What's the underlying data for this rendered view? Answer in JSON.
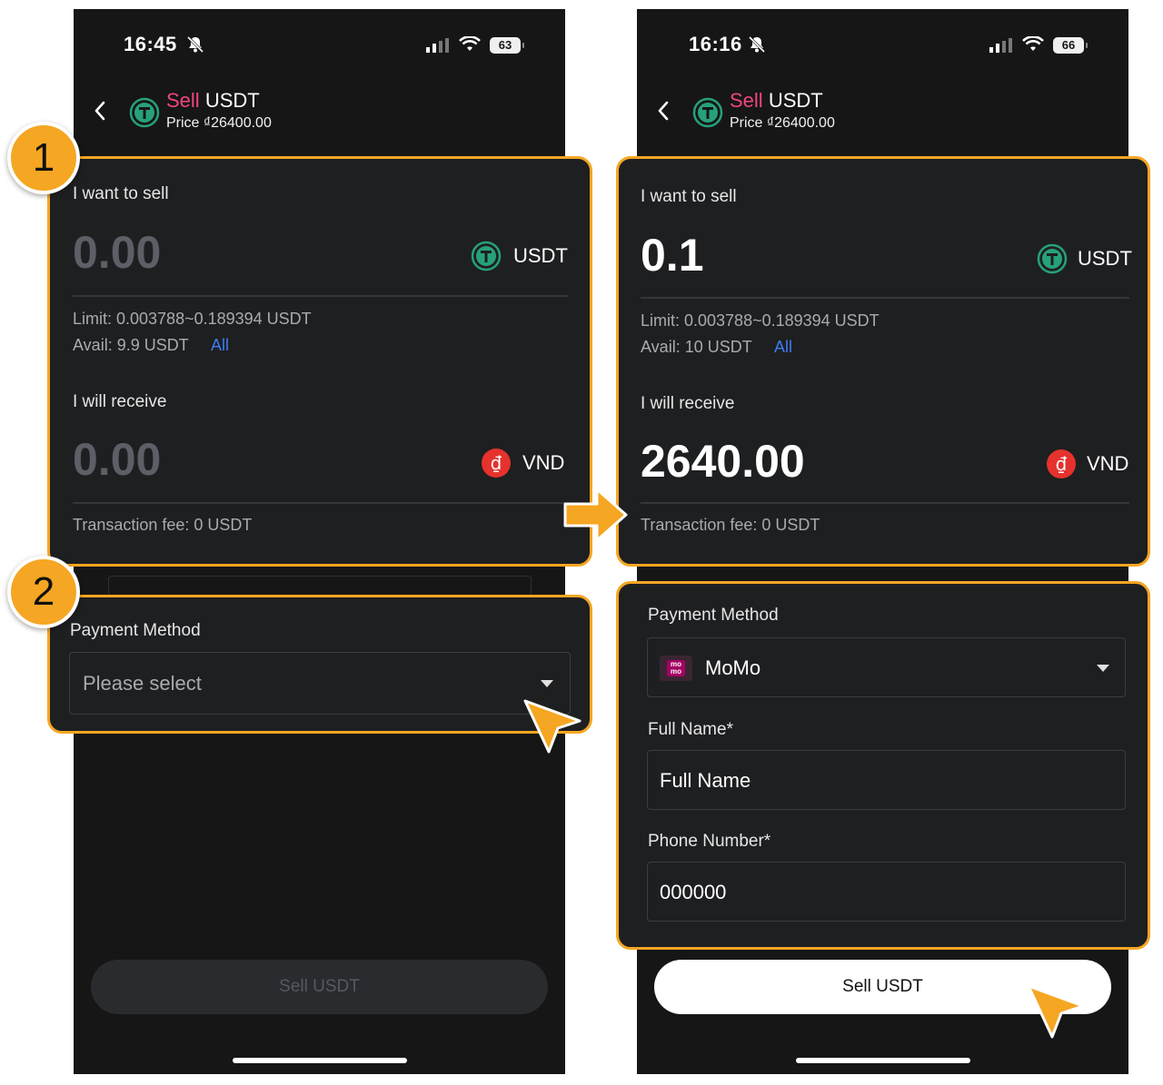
{
  "left": {
    "status": {
      "time": "16:45",
      "battery": "63"
    },
    "header": {
      "sell_word": "Sell",
      "asset": "USDT",
      "price": "Price ₫26400.00"
    },
    "sell_card": {
      "want_label": "I want to sell",
      "amount": "0.00",
      "asset": "USDT",
      "limit": "Limit: 0.003788~0.189394 USDT",
      "avail": "Avail: 9.9 USDT",
      "all_link": "All",
      "receive_label": "I will receive",
      "receive_amount": "0.00",
      "receive_currency": "VND",
      "fee": "Transaction fee: 0 USDT"
    },
    "payment": {
      "label": "Payment Method",
      "placeholder": "Please select"
    },
    "button": "Sell USDT"
  },
  "right": {
    "status": {
      "time": "16:16",
      "battery": "66"
    },
    "header": {
      "sell_word": "Sell",
      "asset": "USDT",
      "price": "Price ₫26400.00"
    },
    "sell_card": {
      "want_label": "I want to sell",
      "amount": "0.1",
      "asset": "USDT",
      "limit": "Limit: 0.003788~0.189394 USDT",
      "avail": "Avail: 10 USDT",
      "all_link": "All",
      "receive_label": "I will receive",
      "receive_amount": "2640.00",
      "receive_currency": "VND",
      "fee": "Transaction fee: 0 USDT"
    },
    "payment": {
      "label": "Payment Method",
      "selected": "MoMo",
      "momo_logo": "mo mo",
      "full_name_label": "Full Name*",
      "full_name_value": "Full Name",
      "phone_label": "Phone Number*",
      "phone_value": "000000"
    },
    "button": "Sell USDT"
  },
  "annotations": {
    "step1": "1",
    "step2": "2"
  },
  "colors": {
    "highlight": "#f5a623",
    "sell_accent": "#f0467c",
    "link": "#3d7cf5",
    "tether": "#26a17b",
    "vnd": "#e5322d"
  }
}
